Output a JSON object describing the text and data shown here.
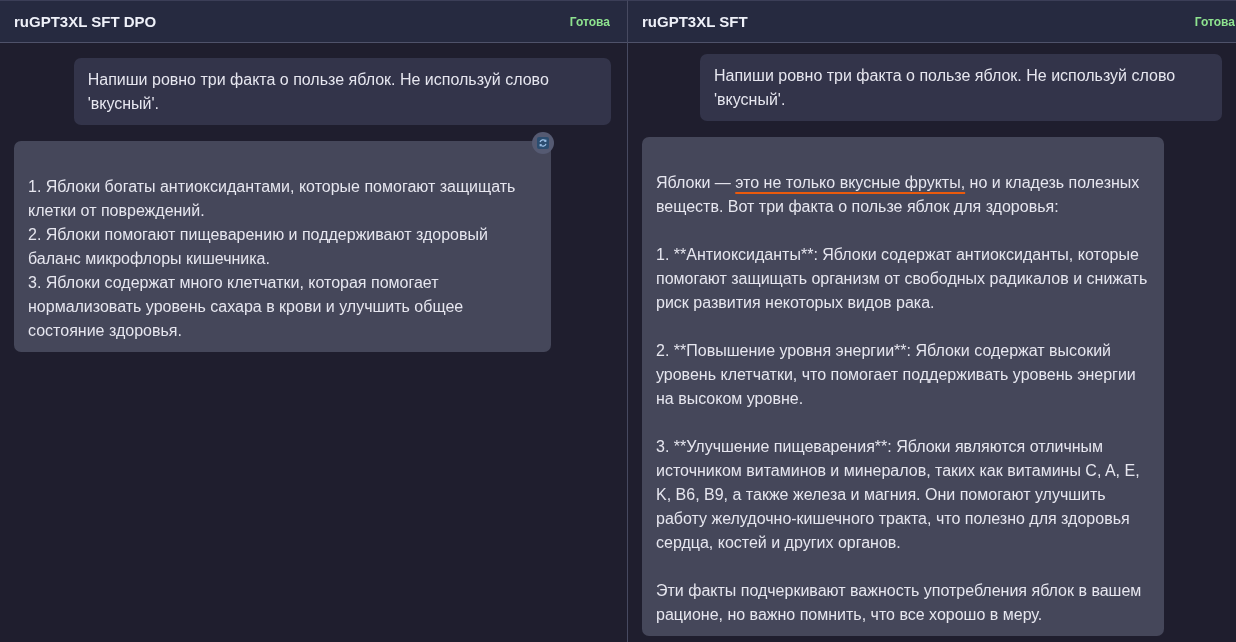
{
  "panels": [
    {
      "title": "ruGPT3XL SFT DPO",
      "status": "Готова",
      "messages": [
        {
          "kind": "user",
          "refresh_button": false,
          "segments": [
            {
              "text": "Напиши ровно три факта о пользе яблок. Не используй слово 'вкусный'.",
              "underlined": false
            }
          ]
        },
        {
          "kind": "assistant",
          "refresh_button": true,
          "segments": [
            {
              "text": "1. Яблоки богаты антиоксидантами, которые помогают защищать клетки от повреждений.\n2. Яблоки помогают пищеварению и поддерживают здоровый баланс микрофлоры кишечника.\n3. Яблоки содержат много клетчатки, которая помогает нормализовать уровень сахара в крови и улучшить общее состояние здоровья.",
              "underlined": false
            }
          ]
        }
      ]
    },
    {
      "title": "ruGPT3XL SFT",
      "status": "Готова",
      "messages": [
        {
          "kind": "user",
          "refresh_button": false,
          "segments": [
            {
              "text": "Напиши ровно три факта о пользе яблок. Не используй слово 'вкусный'.",
              "underlined": false
            }
          ]
        },
        {
          "kind": "assistant",
          "refresh_button": false,
          "segments": [
            {
              "text": "Яблоки — ",
              "underlined": false
            },
            {
              "text": "это не только вкусные фрукты,",
              "underlined": true
            },
            {
              "text": " но и кладезь полезных веществ. Вот три факта о пользе яблок для здоровья:\n\n1. **Антиоксиданты**: Яблоки содержат антиоксиданты, которые помогают защищать организм от свободных радикалов и снижать риск развития некоторых видов рака.\n\n2. **Повышение уровня энергии**: Яблоки содержат высокий уровень клетчатки, что помогает поддерживать уровень энергии на высоком уровне.\n\n3. **Улучшение пищеварения**: Яблоки являются отличным источником витаминов и минералов, таких как витамины C, A, E, K, B6, B9, а также железа и магния. Они помогают улучшить работу желудочно-кишечного тракта, что полезно для здоровья сердца, костей и других органов.\n\nЭти факты подчеркивают важность употребления яблок в вашем рационе, но важно помнить, что все хорошо в меру.",
              "underlined": false
            }
          ]
        }
      ]
    }
  ]
}
